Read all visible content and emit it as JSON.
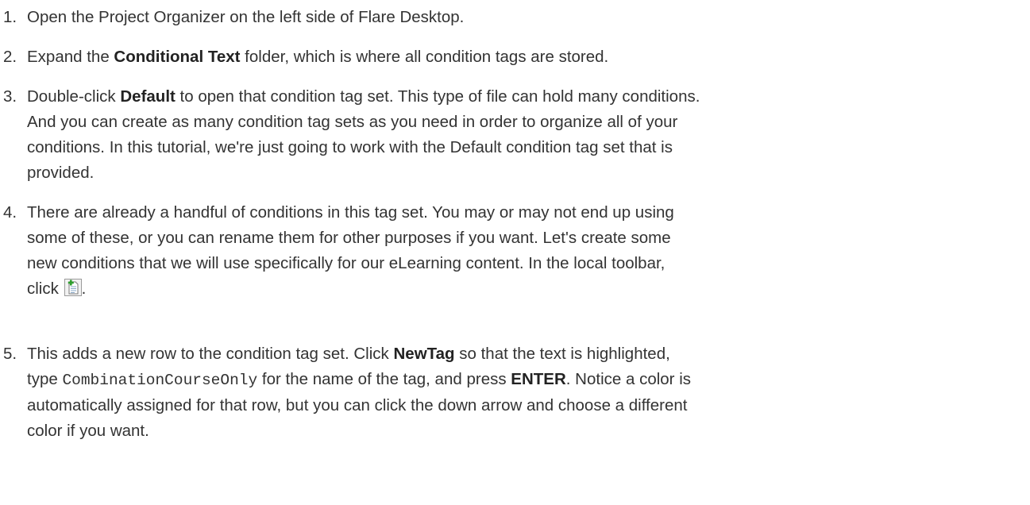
{
  "steps": [
    {
      "number": "1.",
      "line1": "Open the Project Organizer on the left side of Flare Desktop."
    },
    {
      "number": "2.",
      "pre": "Expand the ",
      "ui": "Conditional Text",
      "post": " folder, which is where all condition tags are stored."
    },
    {
      "number": "3.",
      "pre": "Double-click ",
      "ui": "Default",
      "post": " to open that condition tag set. This type of file can hold many conditions.",
      "line2": "And you can create as many condition tag sets as you need in order to organize all of your",
      "line3": "conditions. In this tutorial, we're just going to work with the Default condition tag set that is",
      "line4": "provided."
    },
    {
      "number": "4.",
      "line1": "There are already a handful of conditions in this tag set. You may or may not end up using",
      "line2": "some of these, or you can rename them for other purposes if you want. Let's create some",
      "line3": "new conditions that we will use specifically for our eLearning content. In the local toolbar,",
      "line4_pre": "click ",
      "icon": "new-item-icon",
      "line4_post": "."
    },
    {
      "number": "5.",
      "pre": "This adds a new row to the condition tag set. Click ",
      "ui1": "NewTag",
      "post1": " so that the text is highlighted,",
      "l2_pre": "type ",
      "code": "CombinationCourseOnly",
      "l2_mid": " for the name of the tag, and press ",
      "ui2": "ENTER",
      "l2_post": ". Notice a color is",
      "line3": "automatically assigned for that row, but you can click the down arrow and choose a different",
      "line4": "color if you want."
    }
  ]
}
